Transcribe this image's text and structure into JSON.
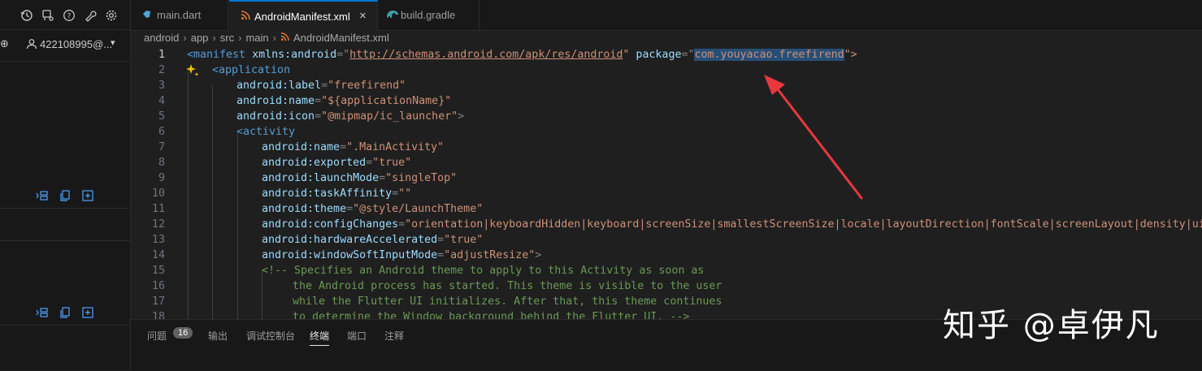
{
  "sidebar": {
    "toolbar_icons": [
      "history-icon",
      "pull-request-icon",
      "help-icon",
      "wrench-icon",
      "gear-icon"
    ],
    "account": {
      "add_icon": "⊕",
      "name": "422108995@...",
      "caret": "▾"
    },
    "section_actions": [
      "collapse-icon",
      "copy-icon",
      "new-icon"
    ]
  },
  "tabs": [
    {
      "label": "main.dart",
      "icon": "dart-icon",
      "active": false
    },
    {
      "label": "AndroidManifest.xml",
      "icon": "rss-icon",
      "active": true,
      "close": "×"
    },
    {
      "label": "build.gradle",
      "icon": "elephant-icon",
      "active": false
    }
  ],
  "breadcrumb": [
    "android",
    "app",
    "src",
    "main",
    "AndroidManifest.xml"
  ],
  "editor": {
    "line_numbers": [
      "1",
      "2",
      "3",
      "4",
      "5",
      "6",
      "7",
      "8",
      "9",
      "10",
      "11",
      "12",
      "13",
      "14",
      "15",
      "16",
      "17",
      "18"
    ],
    "lines": {
      "l1": {
        "a": "<manifest",
        "b": " xmlns:android",
        "c": "=\"",
        "d": "http://schemas.android.com/apk/res/android",
        "e": "\"",
        "f": " package",
        "g": "=\"",
        "h": "com.youyacao.freefirend",
        "i": "\">"
      },
      "l2": {
        "a": "<application"
      },
      "l3": {
        "a": "android:label",
        "b": "=",
        "c": "\"freefirend\""
      },
      "l4": {
        "a": "android:name",
        "b": "=",
        "c": "\"${applicationName}\""
      },
      "l5": {
        "a": "android:icon",
        "b": "=",
        "c": "\"@mipmap/ic_launcher\"",
        "d": ">"
      },
      "l6": {
        "a": "<activity"
      },
      "l7": {
        "a": "android:name",
        "b": "=",
        "c": "\".MainActivity\""
      },
      "l8": {
        "a": "android:exported",
        "b": "=",
        "c": "\"true\""
      },
      "l9": {
        "a": "android:launchMode",
        "b": "=",
        "c": "\"singleTop\""
      },
      "l10": {
        "a": "android:taskAffinity",
        "b": "=",
        "c": "\"\""
      },
      "l11": {
        "a": "android:theme",
        "b": "=",
        "c": "\"@style/LaunchTheme\""
      },
      "l12": {
        "a": "android:configChanges",
        "b": "=",
        "c": "\"orientation|keyboardHidden|keyboard|screenSize|smallestScreenSize|locale|layoutDirection|fontScale|screenLayout|density|uiMode\""
      },
      "l13": {
        "a": "android:hardwareAccelerated",
        "b": "=",
        "c": "\"true\""
      },
      "l14": {
        "a": "android:windowSoftInputMode",
        "b": "=",
        "c": "\"adjustResize\"",
        "d": ">"
      },
      "l15": {
        "a": "<!-- Specifies an Android theme to apply to this Activity as soon as"
      },
      "l16": {
        "a": "the Android process has started. This theme is visible to the user"
      },
      "l17": {
        "a": "while the Flutter UI initializes. After that, this theme continues"
      },
      "l18": {
        "a": "to determine the Window background behind the Flutter UI. -->"
      }
    }
  },
  "panel": {
    "tabs": [
      "问题",
      "输出",
      "调试控制台",
      "终端",
      "端口",
      "注释"
    ],
    "problems_count": "16",
    "active_tab": "终端"
  },
  "watermark": "知乎 @卓伊凡",
  "colors": {
    "accent": "#0078d4",
    "arrow": "#e8383d",
    "selection": "#264f78"
  }
}
